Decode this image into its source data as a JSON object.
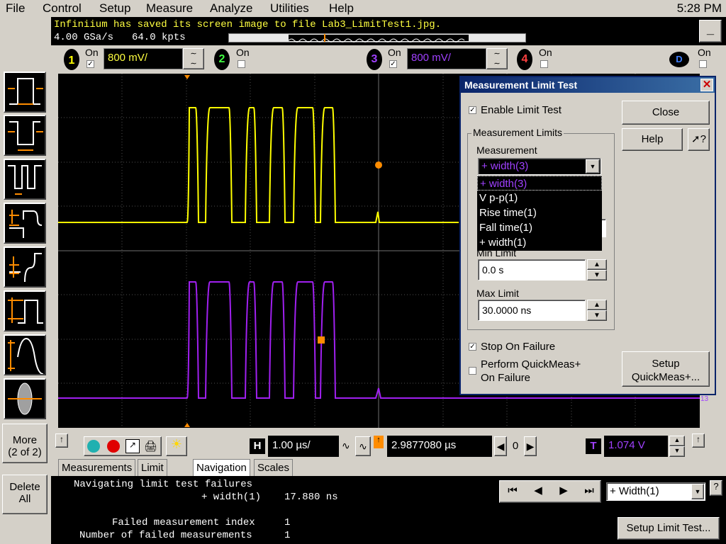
{
  "menu": [
    "File",
    "Control",
    "Setup",
    "Measure",
    "Analyze",
    "Utilities",
    "Help"
  ],
  "clock": "5:28 PM",
  "status": {
    "message": "Infiniium has saved its screen image to file Lab3_LimitTest1.jpg.",
    "sample_rate": "4.00 GSa/s",
    "memory": "64.0 kpts",
    "min_button": "_"
  },
  "channels": [
    {
      "num": "1",
      "on_label": "On",
      "checked": true,
      "volts": "800 mV/",
      "color": "#ffff00"
    },
    {
      "num": "2",
      "on_label": "On",
      "checked": false,
      "color": "#40ff40"
    },
    {
      "num": "3",
      "on_label": "On",
      "checked": true,
      "volts": "800 mV/",
      "color": "#a040ff"
    },
    {
      "num": "4",
      "on_label": "On",
      "checked": false,
      "color": "#ff4040"
    },
    {
      "num": "D",
      "on_label": "On",
      "checked": false,
      "color": "#2060ff"
    }
  ],
  "left_panel": {
    "more_label": "More",
    "more_sub": "(2 of 2)",
    "delete_label": "Delete",
    "delete_sub": "All"
  },
  "dialog": {
    "title": "Measurement Limit Test",
    "enable_label": "Enable Limit Test",
    "close_label": "Close",
    "help_label": "Help",
    "whats_this": "?",
    "group_label": "Measurement Limits",
    "measurement_label": "Measurement",
    "measurement_value": "+ width(3)",
    "options": [
      "+ width(3)",
      "V p-p(1)",
      "Rise time(1)",
      "Fall time(1)",
      "+ width(1)"
    ],
    "min_label": "Min Limit",
    "min_value": "0.0 s",
    "max_label": "Max Limit",
    "max_value": "30.0000 ns",
    "stop_label": "Stop On Failure",
    "quickmeas_label1": "Perform QuickMeas+",
    "quickmeas_label2": "On Failure",
    "setup_qm1": "Setup",
    "setup_qm2": "QuickMeas+..."
  },
  "controls": {
    "h_label": "H",
    "timebase": "1.00 µs/",
    "position": "2.9877080 µs",
    "zero": "0",
    "t_label": "T",
    "trigger_level": "1.074 V",
    "ch_marker": "13"
  },
  "tabs": [
    "Measurements",
    "Limit test",
    "Navigation",
    "Scales"
  ],
  "navigation": {
    "line1": "Navigating limit test failures",
    "line2_label": "+ width(1)",
    "line2_value": "17.880 ns",
    "line3_label": "Failed measurement index",
    "line3_value": "1",
    "line4_label": "Number of failed measurements",
    "line4_value": "1",
    "select_value": "+ Width(1)",
    "setup_limit": "Setup Limit Test...",
    "help_q": "?"
  },
  "colors": {
    "ch1_trace": "#ffff00",
    "ch3_trace": "#a020f0",
    "dialog_title": "#0a246a",
    "marker": "#ff8c00"
  }
}
